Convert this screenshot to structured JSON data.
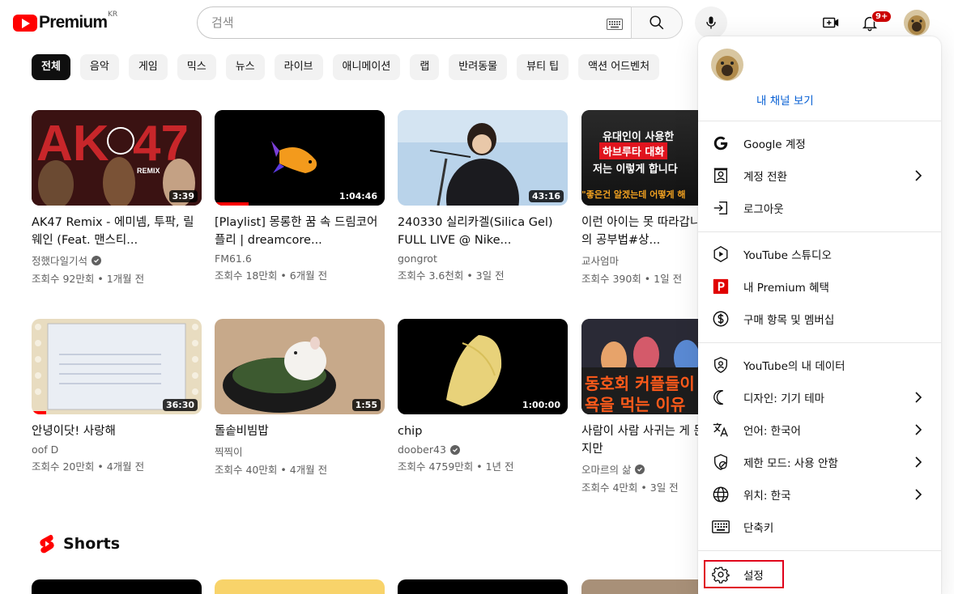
{
  "header": {
    "logo_text": "Premium",
    "logo_region": "KR",
    "search_placeholder": "검색",
    "notification_count": "9+"
  },
  "chips": [
    "전체",
    "음악",
    "게임",
    "믹스",
    "뉴스",
    "라이브",
    "애니메이션",
    "랩",
    "반려동물",
    "뷰티 팁",
    "액션 어드벤처"
  ],
  "videos": [
    {
      "title": "AK47 Remix - 에미넴, 투팍, 릴 웨인 (Feat. 맨스티...",
      "channel": "정했다일기석",
      "verified": true,
      "meta": "조회수 92만회 • 1개월 전",
      "duration": "3:39",
      "thumb_text": "AK47",
      "thumb_sub": "REMIX",
      "progress": 0
    },
    {
      "title": "[Playlist] 몽롱한 꿈 속 드림코어 플리 | dreamcore...",
      "channel": "FM61.6",
      "verified": false,
      "meta": "조회수 18만회 • 6개월 전",
      "duration": "1:04:46",
      "progress": 0.2
    },
    {
      "title": "240330 실리카겔(Silica Gel) FULL LIVE @ Nike...",
      "channel": "gongrot",
      "verified": false,
      "meta": "조회수 3.6천회 • 3일 전",
      "duration": "43:16",
      "progress": 0
    },
    {
      "title": "이런 아이는 못 따라갑니다#최고의 공부법#상...",
      "channel": "교사엄마",
      "verified": false,
      "meta": "조회수 390회 • 1일 전",
      "duration": "",
      "thumb_lines": [
        "유대인이 사용한",
        "하브루타 대화",
        "저는 이렇게 합니다"
      ],
      "thumb_footer": "\"좋은건 알겠는데 어떻게 해",
      "progress": 0
    },
    {
      "title": "안녕이닷! 사랑해",
      "channel": "oof D",
      "verified": false,
      "meta": "조회수 20만회 • 4개월 전",
      "duration": "36:30",
      "progress": 0
    },
    {
      "title": "돌솥비빔밥",
      "channel": "찍찍이",
      "verified": false,
      "meta": "조회수 40만회 • 4개월 전",
      "duration": "1:55",
      "progress": 0
    },
    {
      "title": "chip",
      "channel": "doober43",
      "verified": true,
      "meta": "조회수 4759만회 • 1년 전",
      "duration": "1:00:00",
      "progress": 0
    },
    {
      "title": "사람이 사람 사귀는 게 문제가 아니지만",
      "channel": "오마르의 삶",
      "verified": true,
      "meta": "조회수 4만회 • 3일 전",
      "duration": "",
      "thumb_lines": [
        "동호회 커플들이",
        "욕을 먹는 이유"
      ],
      "progress": 0
    }
  ],
  "shorts": {
    "label": "Shorts"
  },
  "menu": {
    "channel_link": "내 채널 보기",
    "sections": [
      [
        {
          "icon": "google-icon",
          "label": "Google 계정",
          "chevron": false
        },
        {
          "icon": "switch-account-icon",
          "label": "계정 전환",
          "chevron": true
        },
        {
          "icon": "sign-out-icon",
          "label": "로그아웃",
          "chevron": false
        }
      ],
      [
        {
          "icon": "studio-icon",
          "label": "YouTube 스튜디오",
          "chevron": false
        },
        {
          "icon": "premium-icon",
          "label": "내 Premium 혜택",
          "chevron": false
        },
        {
          "icon": "dollar-icon",
          "label": "구매 항목 및 멤버십",
          "chevron": false
        }
      ],
      [
        {
          "icon": "shield-person-icon",
          "label": "YouTube의 내 데이터",
          "chevron": false
        },
        {
          "icon": "moon-icon",
          "label": "디자인: 기기 테마",
          "chevron": true
        },
        {
          "icon": "translate-icon",
          "label": "언어: 한국어",
          "chevron": true
        },
        {
          "icon": "restricted-icon",
          "label": "제한 모드: 사용 안함",
          "chevron": true
        },
        {
          "icon": "globe-icon",
          "label": "위치: 한국",
          "chevron": true
        },
        {
          "icon": "keyboard-icon",
          "label": "단축키",
          "chevron": false
        }
      ],
      [
        {
          "icon": "settings-icon",
          "label": "설정",
          "chevron": false
        }
      ]
    ]
  },
  "colors": {
    "accent": "#ff0000",
    "link": "#065fd4",
    "highlight": "#e0001b"
  }
}
